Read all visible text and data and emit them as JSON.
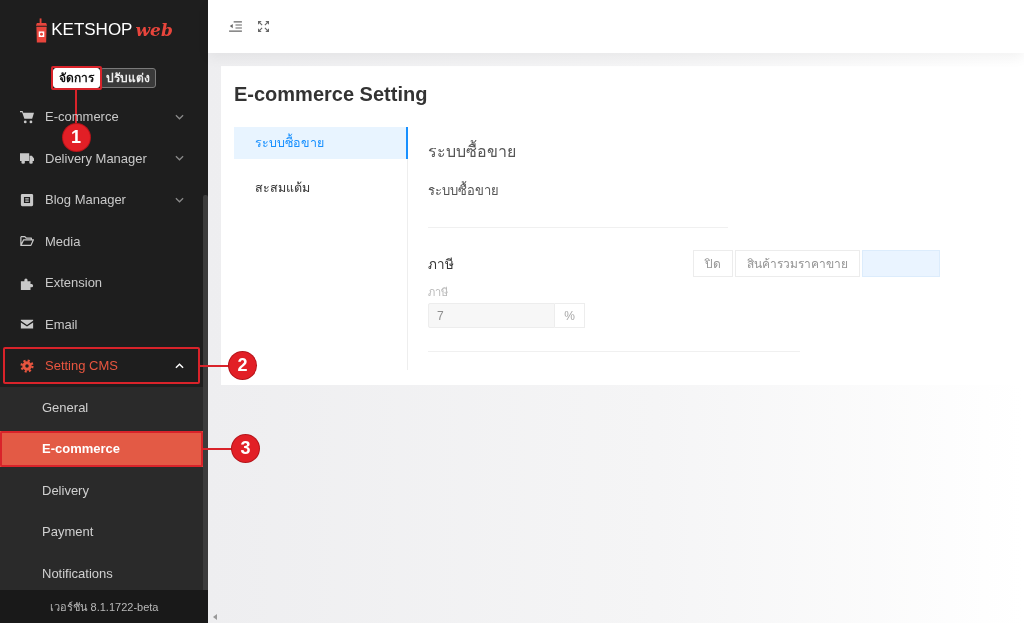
{
  "sidebar": {
    "logo": {
      "name": "KETSHOP",
      "suffix": "web"
    },
    "mode_tabs": [
      {
        "label": "จัดการ",
        "selected": true,
        "callout": "1"
      },
      {
        "label": "ปรับแต่ง",
        "selected": false
      }
    ],
    "items": [
      {
        "label": "E-commerce",
        "kind": "group",
        "expanded": false,
        "selected": false
      },
      {
        "label": "Delivery Manager",
        "kind": "group",
        "expanded": false,
        "selected": false
      },
      {
        "label": "Blog Manager",
        "kind": "group",
        "expanded": false,
        "selected": false
      },
      {
        "label": "Media",
        "kind": "link",
        "selected": false
      },
      {
        "label": "Extension",
        "kind": "link",
        "selected": false
      },
      {
        "label": "Email",
        "kind": "link",
        "selected": false
      },
      {
        "label": "Setting CMS",
        "kind": "group",
        "expanded": true,
        "selected": true,
        "callout": "2",
        "children": [
          {
            "label": "General",
            "selected": false
          },
          {
            "label": "E-commerce",
            "selected": true,
            "callout": "3"
          },
          {
            "label": "Delivery",
            "selected": false
          },
          {
            "label": "Payment",
            "selected": false
          },
          {
            "label": "Notifications",
            "selected": false
          }
        ]
      }
    ],
    "version": "เวอร์ชัน 8.1.1722-beta"
  },
  "page": {
    "title": "E-commerce Setting",
    "tabs": [
      {
        "label": "ระบบซื้อขาย",
        "selected": true
      },
      {
        "label": "สะสมแต้ม",
        "selected": false
      }
    ],
    "section_title": "ระบบซื้อขาย",
    "section_subtitle": "ระบบซื้อขาย",
    "tax": {
      "label": "ภาษี",
      "options": [
        {
          "label": "ปิด",
          "selected": false
        },
        {
          "label": "สินค้ารวมราคาขาย",
          "selected": false
        },
        {
          "selected": true
        }
      ],
      "field_label": "ภาษี",
      "value": "7",
      "unit": "%",
      "disabled": true
    }
  }
}
